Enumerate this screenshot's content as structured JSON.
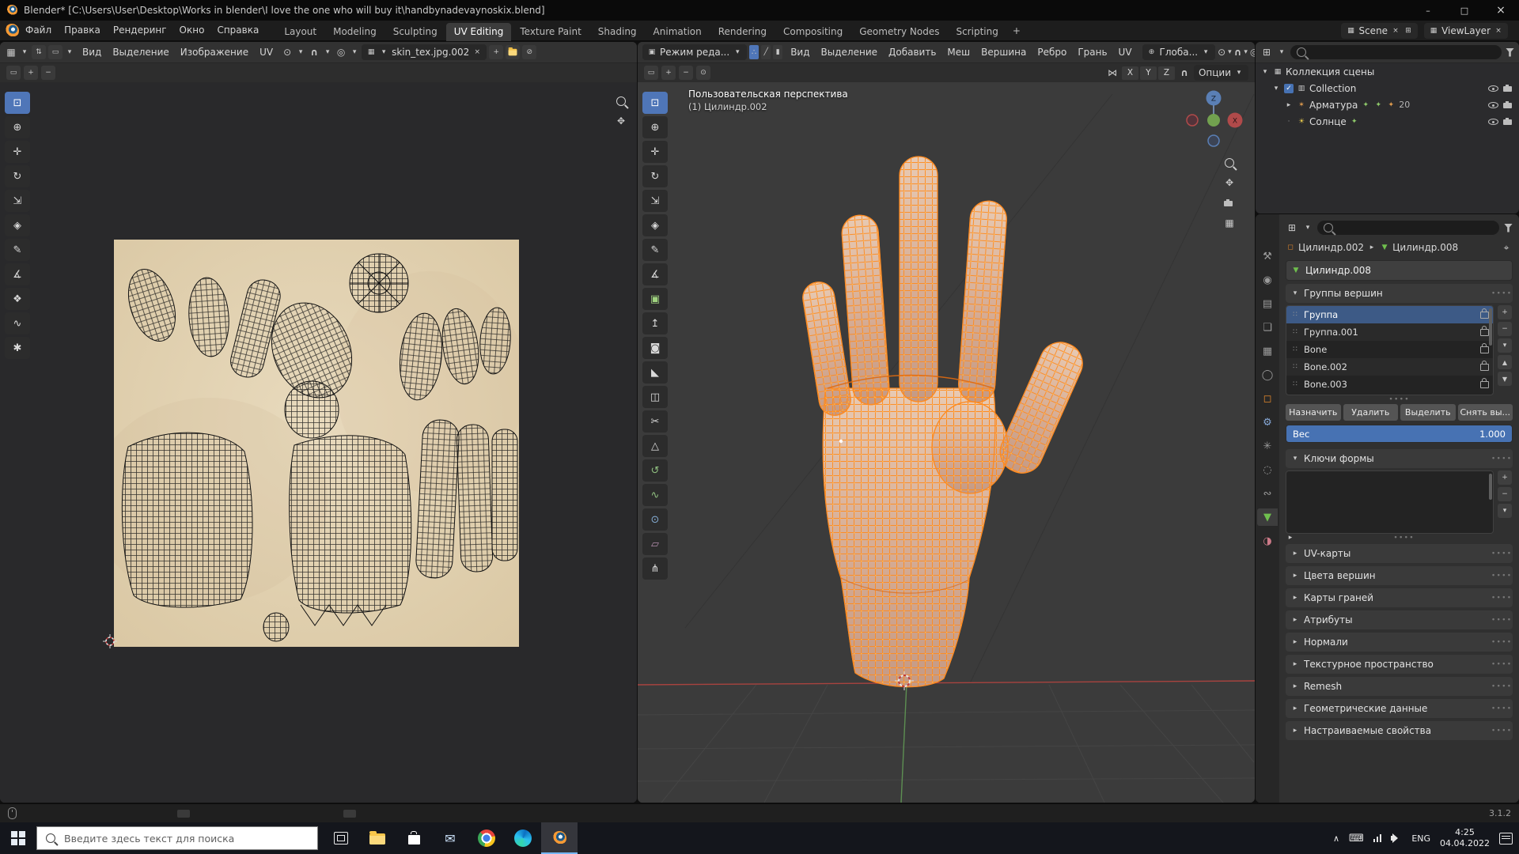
{
  "colors": {
    "accent_blue": "#4772b3",
    "blender_orange": "#f79a34",
    "wire_orange": "#ff8a1e",
    "selected_row": "#3d5a86",
    "uv_texture_bg": "#e0cfae"
  },
  "icons": {
    "blender-logo": "orange-circle-logo",
    "search-icon": "magnifier",
    "filter-icon": "funnel",
    "eye-icon": "visibility-eye",
    "camera-icon": "render-camera",
    "lock-icon": "padlock",
    "caret-down-icon": "▾",
    "caret-right-icon": "▸",
    "magnet-icon": "∩",
    "pivot-icon": "⊙",
    "proportional-icon": "◎",
    "mirror-icon": "⋈",
    "grid-icon": "▦"
  },
  "window": {
    "title": "Blender* [C:\\Users\\User\\Desktop\\Works in blender\\I love the one who will buy it\\handbynadevaynoskix.blend]"
  },
  "topbar": {
    "menus": [
      "Файл",
      "Правка",
      "Рендеринг",
      "Окно",
      "Справка"
    ],
    "workspaces": [
      {
        "label": "Layout"
      },
      {
        "label": "Modeling"
      },
      {
        "label": "Sculpting"
      },
      {
        "label": "UV Editing",
        "active": true
      },
      {
        "label": "Texture Paint"
      },
      {
        "label": "Shading"
      },
      {
        "label": "Animation"
      },
      {
        "label": "Rendering"
      },
      {
        "label": "Compositing"
      },
      {
        "label": "Geometry Nodes"
      },
      {
        "label": "Scripting"
      }
    ],
    "add_workspace": "+",
    "scene_label": "Scene",
    "viewlayer_label": "ViewLayer"
  },
  "uv_editor": {
    "menus": [
      "Вид",
      "Выделение",
      "Изображение",
      "UV"
    ],
    "image_name": "skin_tex.jpg.002",
    "tools": [
      {
        "name": "select-box-tool",
        "glyph": "⊡",
        "active": true
      },
      {
        "name": "cursor-tool",
        "glyph": "⊕"
      },
      {
        "name": "move-tool",
        "glyph": "✛"
      },
      {
        "name": "rotate-tool",
        "glyph": "↻"
      },
      {
        "name": "scale-tool",
        "glyph": "⇲"
      },
      {
        "name": "transform-tool",
        "glyph": "◈"
      },
      {
        "name": "annotate-tool",
        "glyph": "✎"
      },
      {
        "name": "measure-tool",
        "glyph": "∡"
      },
      {
        "name": "grab-tool",
        "glyph": "❖"
      },
      {
        "name": "relax-tool",
        "glyph": "∿"
      },
      {
        "name": "pinch-tool",
        "glyph": "✱"
      }
    ]
  },
  "viewport": {
    "mode": "Режим реда...",
    "menus": [
      "Вид",
      "Выделение",
      "Добавить",
      "Меш",
      "Вершина",
      "Ребро",
      "Грань",
      "UV"
    ],
    "orientation": "Глоба...",
    "options": "Опции",
    "mirror_axes": [
      "X",
      "Y",
      "Z"
    ],
    "overlay": {
      "perspective": "Пользовательская перспектива",
      "object": "(1) Цилиндр.002"
    },
    "gizmo": {
      "z": "Z",
      "x": "X"
    },
    "tools": [
      {
        "name": "select-box-tool",
        "glyph": "⊡",
        "active": true
      },
      {
        "name": "cursor-tool",
        "glyph": "⊕"
      },
      {
        "name": "move-tool",
        "glyph": "✛"
      },
      {
        "name": "rotate-tool",
        "glyph": "↻"
      },
      {
        "name": "scale-tool",
        "glyph": "⇲"
      },
      {
        "name": "transform-tool",
        "glyph": "◈"
      },
      {
        "name": "annotate-tool",
        "glyph": "✎"
      },
      {
        "name": "measure-tool",
        "glyph": "∡"
      },
      {
        "name": "add-cube-tool",
        "glyph": "▣",
        "color": "#9fd27f"
      },
      {
        "name": "extrude-tool",
        "glyph": "↥"
      },
      {
        "name": "inset-faces-tool",
        "glyph": "◙"
      },
      {
        "name": "bevel-tool",
        "glyph": "◣"
      },
      {
        "name": "loop-cut-tool",
        "glyph": "◫"
      },
      {
        "name": "knife-tool",
        "glyph": "✂"
      },
      {
        "name": "poly-build-tool",
        "glyph": "△"
      },
      {
        "name": "spin-tool",
        "glyph": "↺",
        "color": "#8fbf7f"
      },
      {
        "name": "smooth-tool",
        "glyph": "∿",
        "color": "#8fbf7f"
      },
      {
        "name": "shrink-fatten-tool",
        "glyph": "⊙",
        "color": "#85aed6"
      },
      {
        "name": "shear-tool",
        "glyph": "▱",
        "color": "#b48ead"
      },
      {
        "name": "rip-region-tool",
        "glyph": "⋔"
      }
    ]
  },
  "outliner": {
    "root_label": "Коллекция сцены",
    "collection_label": "Collection",
    "armature_label": "Арматура",
    "armature_count": "20",
    "sun_label": "Солнце"
  },
  "properties": {
    "tabs": [
      {
        "name": "tool-tab",
        "glyph": "⚒"
      },
      {
        "name": "render-tab",
        "glyph": "◉"
      },
      {
        "name": "output-tab",
        "glyph": "▤"
      },
      {
        "name": "view-layer-tab",
        "glyph": "❏"
      },
      {
        "name": "scene-tab",
        "glyph": "▦"
      },
      {
        "name": "world-tab",
        "glyph": "◯"
      },
      {
        "name": "object-tab",
        "glyph": "◻",
        "color": "#e0862c"
      },
      {
        "name": "modifiers-tab",
        "glyph": "⚙",
        "color": "#87a9d8"
      },
      {
        "name": "particles-tab",
        "glyph": "✳"
      },
      {
        "name": "physics-tab",
        "glyph": "◌"
      },
      {
        "name": "constraints-tab",
        "glyph": "∾"
      },
      {
        "name": "object-data-tab",
        "glyph": "▼",
        "color": "#6fbf4e",
        "active": true
      },
      {
        "name": "material-tab",
        "glyph": "◑",
        "color": "#cc7a88"
      }
    ],
    "breadcrumb": {
      "object": "Цилиндр.002",
      "data": "Цилиндр.008"
    },
    "name_field": "Цилиндр.008",
    "vertex_groups": {
      "title": "Группы вершин",
      "items": [
        {
          "name": "Группа",
          "selected": true
        },
        {
          "name": "Группа.001"
        },
        {
          "name": "Bone"
        },
        {
          "name": "Bone.002"
        },
        {
          "name": "Bone.003"
        }
      ],
      "buttons": [
        "Назначить",
        "Удалить",
        "Выделить",
        "Снять вы..."
      ],
      "weight_label": "Вес",
      "weight_value": "1.000"
    },
    "shape_keys_title": "Ключи формы",
    "collapsed_panels": [
      "UV-карты",
      "Цвета вершин",
      "Карты граней",
      "Атрибуты",
      "Нормали",
      "Текстурное пространство",
      "Remesh",
      "Геометрические данные",
      "Настраиваемые свойства"
    ]
  },
  "statusbar": {
    "version": "3.1.2"
  },
  "taskbar": {
    "search_placeholder": "Введите здесь текст для поиска",
    "language": "ENG",
    "time": "4:25",
    "date": "04.04.2022"
  }
}
